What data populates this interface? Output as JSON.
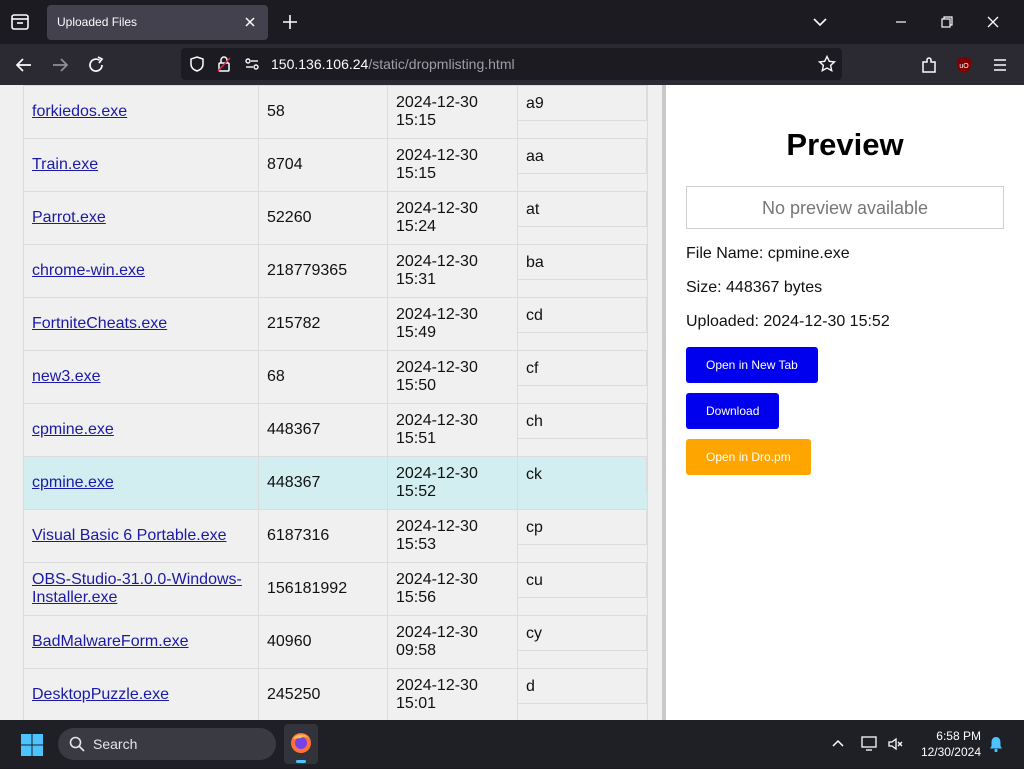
{
  "browser": {
    "tab_title": "Uploaded Files",
    "url_host": "150.136.106.24",
    "url_path": "/static/dropmlisting.html"
  },
  "files": [
    {
      "name": "forkiedos.exe",
      "size": "58",
      "date": "2024-12-30",
      "time": "15:15",
      "hash": "a9"
    },
    {
      "name": "Train.exe",
      "size": "8704",
      "date": "2024-12-30",
      "time": "15:15",
      "hash": "aa"
    },
    {
      "name": "Parrot.exe",
      "size": "52260",
      "date": "2024-12-30",
      "time": "15:24",
      "hash": "at"
    },
    {
      "name": "chrome-win.exe",
      "size": "218779365",
      "date": "2024-12-30",
      "time": "15:31",
      "hash": "ba"
    },
    {
      "name": "FortniteCheats.exe",
      "size": "215782",
      "date": "2024-12-30",
      "time": "15:49",
      "hash": "cd"
    },
    {
      "name": "new3.exe",
      "size": "68",
      "date": "2024-12-30",
      "time": "15:50",
      "hash": "cf"
    },
    {
      "name": "cpmine.exe",
      "size": "448367",
      "date": "2024-12-30",
      "time": "15:51",
      "hash": "ch"
    },
    {
      "name": "cpmine.exe",
      "size": "448367",
      "date": "2024-12-30",
      "time": "15:52",
      "hash": "ck",
      "selected": true
    },
    {
      "name": "Visual Basic 6 Portable.exe",
      "size": "6187316",
      "date": "2024-12-30",
      "time": "15:53",
      "hash": "cp"
    },
    {
      "name": "OBS-Studio-31.0.0-Windows-Installer.exe",
      "name_line1": "OBS-Studio-31.0.0-Windows-",
      "name_line2": "Installer.exe",
      "size": "156181992",
      "date": "2024-12-30",
      "time": "15:56",
      "hash": "cu"
    },
    {
      "name": "BadMalwareForm.exe",
      "size": "40960",
      "date": "2024-12-30",
      "time": "09:58",
      "hash": "cy"
    },
    {
      "name": "DesktopPuzzle.exe",
      "size": "245250",
      "date": "2024-12-30",
      "time": "15:01",
      "hash": "d"
    }
  ],
  "preview": {
    "title": "Preview",
    "no_preview": "No preview available",
    "file_name": "File Name: cpmine.exe",
    "size": "Size: 448367 bytes",
    "uploaded": "Uploaded: 2024-12-30 15:52",
    "btn_open_new_tab": "Open in New Tab",
    "btn_download": "Download",
    "btn_open_dropm": "Open in Dro.pm"
  },
  "colors": {
    "btn_blue": "#0000ee",
    "btn_orange": "#ffa500",
    "selected_row": "#d3eef0"
  },
  "taskbar": {
    "search_label": "Search",
    "time": "6:58 PM",
    "date": "12/30/2024"
  }
}
